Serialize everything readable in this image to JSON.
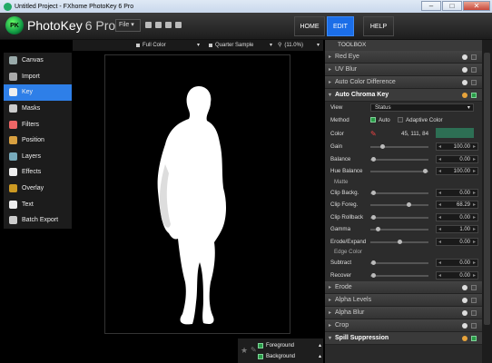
{
  "window": {
    "title": "Untitled Project - FXhome PhotoKey 6 Pro",
    "minimize": "–",
    "maximize": "□",
    "close": "✕"
  },
  "app": {
    "logo_text": "PK",
    "name": "PhotoKey",
    "version": "6 Pro",
    "file_menu": "File",
    "file_caret": "▾"
  },
  "nav": {
    "home": "HOME",
    "edit": "EDIT",
    "help": "HELP"
  },
  "options": {
    "color_mode": "Full Color",
    "sample": "Quarter Sample",
    "zoom": "(11.0%)",
    "caret": "▾"
  },
  "sidebar": {
    "items": [
      {
        "label": "Canvas",
        "icon": "canvas-icon",
        "color": "#9aa"
      },
      {
        "label": "Import",
        "icon": "import-icon",
        "color": "#aaa"
      },
      {
        "label": "Key",
        "icon": "key-icon",
        "color": "#eee"
      },
      {
        "label": "Masks",
        "icon": "masks-icon",
        "color": "#ccc"
      },
      {
        "label": "Filters",
        "icon": "filters-icon",
        "color": "#e66"
      },
      {
        "label": "Position",
        "icon": "position-icon",
        "color": "#d8a040"
      },
      {
        "label": "Layers",
        "icon": "layers-icon",
        "color": "#7ab"
      },
      {
        "label": "Effects",
        "icon": "effects-icon",
        "color": "#eee"
      },
      {
        "label": "Overlay",
        "icon": "overlay-icon",
        "color": "#c92"
      },
      {
        "label": "Text",
        "icon": "text-icon",
        "color": "#eee"
      },
      {
        "label": "Batch Export",
        "icon": "batch-export-icon",
        "color": "#ccc"
      }
    ],
    "active_index": 2
  },
  "layers": {
    "foreground": "Foreground",
    "background": "Background",
    "caret": "▴"
  },
  "toolbox": {
    "title": "TOOLBOX",
    "expanded_arrow": "▾",
    "collapsed_arrow": "▸",
    "top_sections": [
      "Red Eye",
      "UV Blur",
      "Auto Color Difference"
    ],
    "open_section": "Auto Chroma Key",
    "view_label": "View",
    "view_value": "Status",
    "method_label": "Method",
    "method_auto": "Auto",
    "method_adaptive": "Adaptive Color",
    "color_label": "Color",
    "color_value": "45, 111, 84",
    "key_color": "#2d6f54",
    "arrow_left": "◂",
    "arrow_right": "▸",
    "params1": [
      {
        "label": "Gain",
        "value": "100.00",
        "knob": 0.18
      },
      {
        "label": "Balance",
        "value": "0.00",
        "knob": 0.02
      },
      {
        "label": "Hue Balance",
        "value": "100.00",
        "knob": 0.98
      }
    ],
    "matte_title": "Matte",
    "params2": [
      {
        "label": "Clip Backg.",
        "value": "0.00",
        "knob": 0.02
      },
      {
        "label": "Clip Foreg.",
        "value": "68.29",
        "knob": 0.68
      },
      {
        "label": "Clip Rollback",
        "value": "0.00",
        "knob": 0.02
      },
      {
        "label": "Gamma",
        "value": "1.00",
        "knob": 0.1
      },
      {
        "label": "Erode/Expand",
        "value": "0.00",
        "knob": 0.5
      }
    ],
    "edge_title": "Edge Color",
    "params3": [
      {
        "label": "Subtract",
        "value": "0.00",
        "knob": 0.02
      },
      {
        "label": "Recover",
        "value": "0.00",
        "knob": 0.02
      }
    ],
    "bottom_sections": [
      "Erode",
      "Alpha Levels",
      "Alpha Blur",
      "Crop"
    ],
    "last_section": "Spill Suppression"
  }
}
